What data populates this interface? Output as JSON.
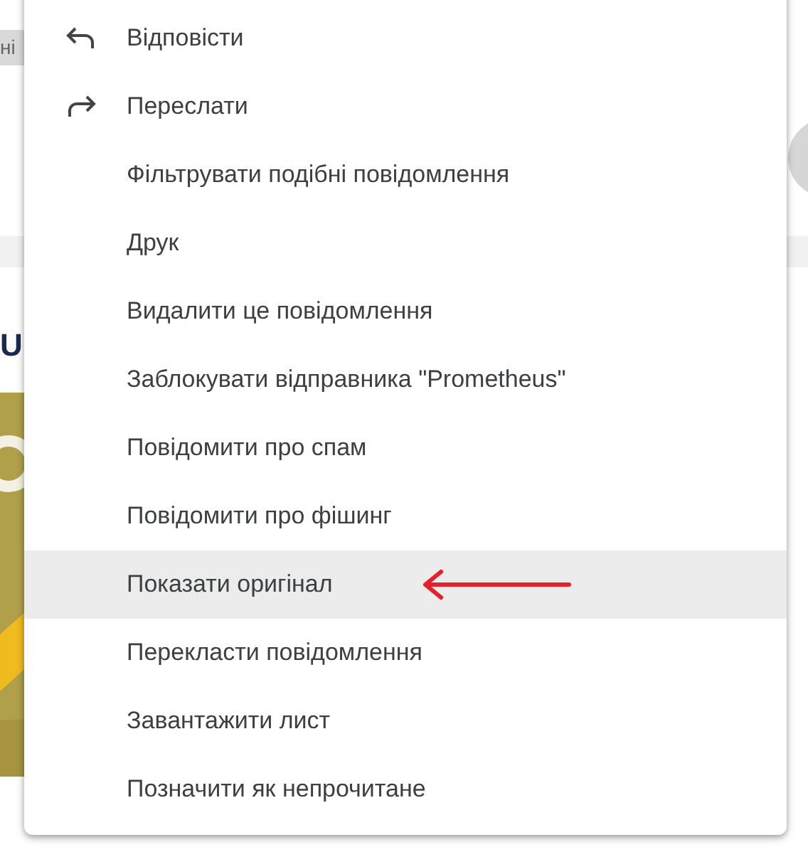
{
  "background": {
    "chip": "ні",
    "heading": "U"
  },
  "menu": {
    "items": [
      {
        "label": "Відповісти",
        "kind": "reply",
        "selected": false
      },
      {
        "label": "Переслати",
        "kind": "forward",
        "selected": false
      },
      {
        "label": "Фільтрувати подібні повідомлення",
        "kind": "plain",
        "selected": false
      },
      {
        "label": "Друк",
        "kind": "plain",
        "selected": false
      },
      {
        "label": "Видалити це повідомлення",
        "kind": "plain",
        "selected": false
      },
      {
        "label": "Заблокувати відправника \"Prometheus\"",
        "kind": "plain",
        "selected": false
      },
      {
        "label": "Повідомити про спам",
        "kind": "plain",
        "selected": false
      },
      {
        "label": "Повідомити про фішинг",
        "kind": "plain",
        "selected": false
      },
      {
        "label": "Показати оригінал",
        "kind": "plain",
        "selected": true
      },
      {
        "label": "Перекласти повідомлення",
        "kind": "plain",
        "selected": false
      },
      {
        "label": "Завантажити лист",
        "kind": "plain",
        "selected": false
      },
      {
        "label": "Позначити як непрочитане",
        "kind": "plain",
        "selected": false
      }
    ]
  }
}
